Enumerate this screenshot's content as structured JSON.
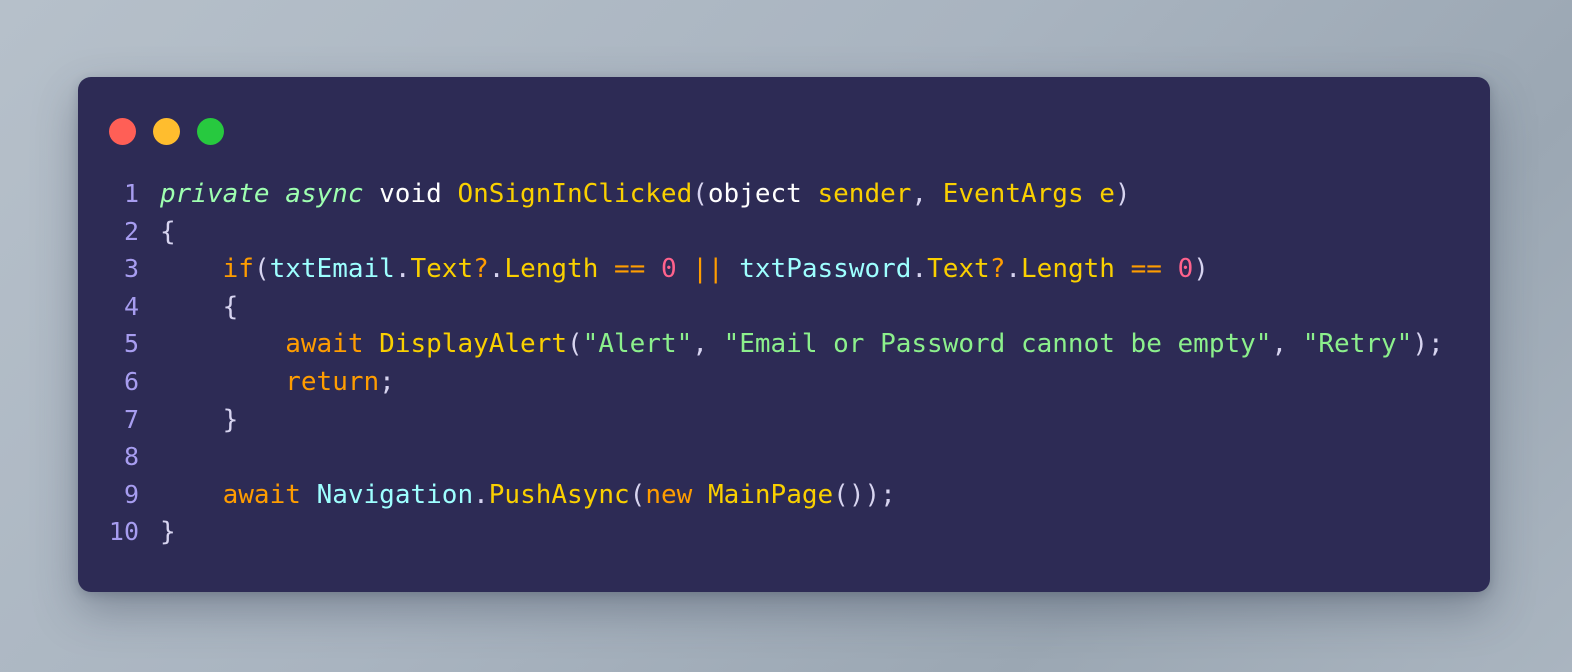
{
  "window": {
    "controls": [
      {
        "name": "close",
        "color": "#ff5f56",
        "label": "Close"
      },
      {
        "name": "minimize",
        "color": "#ffbd2e",
        "label": "Minimize"
      },
      {
        "name": "maximize",
        "color": "#27c93f",
        "label": "Maximize"
      }
    ]
  },
  "theme": {
    "background": "#2d2b55",
    "page_background": "#aab5c0",
    "line_number_color": "#a79df0",
    "keyword": "#9effb0",
    "function": "#fad000",
    "identifier": "#9effff",
    "operator": "#ff9d00",
    "number": "#ff628c",
    "string": "#8cf08c",
    "punctuation": "#d7d4f0",
    "plain": "#ffffff"
  },
  "editor": {
    "language": "csharp",
    "line_numbers": [
      "1",
      "2",
      "3",
      "4",
      "5",
      "6",
      "7",
      "8",
      "9",
      "10"
    ],
    "lines": [
      {
        "number": "1",
        "text": "private async void OnSignInClicked(object sender, EventArgs e)",
        "tokens": [
          {
            "t": "private async",
            "c": "kw"
          },
          {
            "t": " ",
            "c": "plain"
          },
          {
            "t": "void",
            "c": "type"
          },
          {
            "t": " ",
            "c": "plain"
          },
          {
            "t": "OnSignInClicked",
            "c": "fn"
          },
          {
            "t": "(",
            "c": "punc"
          },
          {
            "t": "object",
            "c": "type"
          },
          {
            "t": " ",
            "c": "plain"
          },
          {
            "t": "sender",
            "c": "cls"
          },
          {
            "t": ",",
            "c": "punc"
          },
          {
            "t": " ",
            "c": "plain"
          },
          {
            "t": "EventArgs e",
            "c": "cls"
          },
          {
            "t": ")",
            "c": "punc"
          }
        ]
      },
      {
        "number": "2",
        "text": "{",
        "tokens": [
          {
            "t": "{",
            "c": "punc"
          }
        ]
      },
      {
        "number": "3",
        "text": "    if(txtEmail.Text?.Length == 0 || txtPassword.Text?.Length == 0)",
        "tokens": [
          {
            "t": "    ",
            "c": "plain"
          },
          {
            "t": "if",
            "c": "op"
          },
          {
            "t": "(",
            "c": "punc"
          },
          {
            "t": "txtEmail",
            "c": "id"
          },
          {
            "t": ".",
            "c": "punc"
          },
          {
            "t": "Text",
            "c": "prop"
          },
          {
            "t": "?",
            "c": "op"
          },
          {
            "t": ".",
            "c": "punc"
          },
          {
            "t": "Length",
            "c": "prop"
          },
          {
            "t": " ",
            "c": "plain"
          },
          {
            "t": "==",
            "c": "op"
          },
          {
            "t": " ",
            "c": "plain"
          },
          {
            "t": "0",
            "c": "num"
          },
          {
            "t": " ",
            "c": "plain"
          },
          {
            "t": "||",
            "c": "op"
          },
          {
            "t": " ",
            "c": "plain"
          },
          {
            "t": "txtPassword",
            "c": "id"
          },
          {
            "t": ".",
            "c": "punc"
          },
          {
            "t": "Text",
            "c": "prop"
          },
          {
            "t": "?",
            "c": "op"
          },
          {
            "t": ".",
            "c": "punc"
          },
          {
            "t": "Length",
            "c": "prop"
          },
          {
            "t": " ",
            "c": "plain"
          },
          {
            "t": "==",
            "c": "op"
          },
          {
            "t": " ",
            "c": "plain"
          },
          {
            "t": "0",
            "c": "num"
          },
          {
            "t": ")",
            "c": "punc"
          }
        ]
      },
      {
        "number": "4",
        "text": "    {",
        "tokens": [
          {
            "t": "    ",
            "c": "plain"
          },
          {
            "t": "{",
            "c": "punc"
          }
        ]
      },
      {
        "number": "5",
        "text": "        await DisplayAlert(\"Alert\", \"Email or Password cannot be empty\", \"Retry\");",
        "tokens": [
          {
            "t": "        ",
            "c": "plain"
          },
          {
            "t": "await",
            "c": "ctrl"
          },
          {
            "t": " ",
            "c": "plain"
          },
          {
            "t": "DisplayAlert",
            "c": "fn"
          },
          {
            "t": "(",
            "c": "punc"
          },
          {
            "t": "\"Alert\"",
            "c": "str"
          },
          {
            "t": ",",
            "c": "punc"
          },
          {
            "t": " ",
            "c": "plain"
          },
          {
            "t": "\"Email or Password cannot be empty\"",
            "c": "str"
          },
          {
            "t": ",",
            "c": "punc"
          },
          {
            "t": " ",
            "c": "plain"
          },
          {
            "t": "\"Retry\"",
            "c": "str"
          },
          {
            "t": ");",
            "c": "punc"
          }
        ]
      },
      {
        "number": "6",
        "text": "        return;",
        "tokens": [
          {
            "t": "        ",
            "c": "plain"
          },
          {
            "t": "return",
            "c": "ctrl"
          },
          {
            "t": ";",
            "c": "punc"
          }
        ]
      },
      {
        "number": "7",
        "text": "    }",
        "tokens": [
          {
            "t": "    ",
            "c": "plain"
          },
          {
            "t": "}",
            "c": "punc"
          }
        ]
      },
      {
        "number": "8",
        "text": "",
        "tokens": []
      },
      {
        "number": "9",
        "text": "    await Navigation.PushAsync(new MainPage());",
        "tokens": [
          {
            "t": "    ",
            "c": "plain"
          },
          {
            "t": "await",
            "c": "ctrl"
          },
          {
            "t": " ",
            "c": "plain"
          },
          {
            "t": "Navigation",
            "c": "id"
          },
          {
            "t": ".",
            "c": "punc"
          },
          {
            "t": "PushAsync",
            "c": "fn"
          },
          {
            "t": "(",
            "c": "punc"
          },
          {
            "t": "new",
            "c": "ctrl"
          },
          {
            "t": " ",
            "c": "plain"
          },
          {
            "t": "MainPage",
            "c": "cls"
          },
          {
            "t": "());",
            "c": "punc"
          }
        ]
      },
      {
        "number": "10",
        "text": "}",
        "tokens": [
          {
            "t": "}",
            "c": "punc"
          }
        ]
      }
    ]
  }
}
